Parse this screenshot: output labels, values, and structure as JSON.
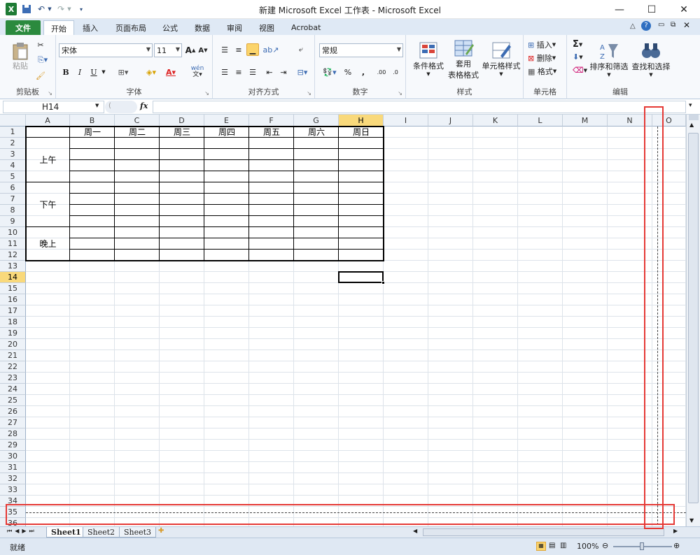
{
  "window": {
    "title": "新建 Microsoft Excel 工作表 - Microsoft Excel",
    "minimize": "—",
    "maximize": "☐",
    "close": "✕"
  },
  "quick_access": {
    "excel_icon": "excel-logo",
    "save": "save-icon",
    "undo": "undo-icon",
    "redo": "redo-icon",
    "customize": "customize-icon"
  },
  "tabs": [
    "文件",
    "开始",
    "插入",
    "页面布局",
    "公式",
    "数据",
    "审阅",
    "视图",
    "Acrobat"
  ],
  "active_tab": "开始",
  "ribbon": {
    "clipboard": {
      "label": "剪贴板",
      "paste": "粘贴"
    },
    "font": {
      "label": "字体",
      "name": "宋体",
      "size": "11",
      "bold": "B",
      "italic": "I",
      "underline": "U",
      "wen": "wén"
    },
    "alignment": {
      "label": "对齐方式"
    },
    "number": {
      "label": "数字",
      "format": "常规",
      "percent": "%",
      "comma": ","
    },
    "styles": {
      "label": "样式",
      "conditional": "条件格式",
      "table_format_1": "套用",
      "table_format_2": "表格格式",
      "cell_styles": "单元格样式"
    },
    "cells": {
      "label": "单元格",
      "insert": "插入",
      "delete": "删除",
      "format": "格式"
    },
    "editing": {
      "label": "编辑",
      "sigma": "Σ",
      "sort": "排序和筛选",
      "find": "查找和选择"
    }
  },
  "formula_bar": {
    "name_box": "H14",
    "fx": "fx",
    "content": ""
  },
  "columns": [
    "A",
    "B",
    "C",
    "D",
    "E",
    "F",
    "G",
    "H",
    "I",
    "J",
    "K",
    "L",
    "M",
    "N",
    "O"
  ],
  "active_column": "H",
  "rows": [
    "1",
    "2",
    "3",
    "4",
    "5",
    "6",
    "7",
    "8",
    "9",
    "10",
    "11",
    "12",
    "13",
    "14",
    "15",
    "16",
    "17",
    "18",
    "19",
    "20",
    "21",
    "22",
    "23",
    "24",
    "25",
    "26",
    "27",
    "28",
    "29",
    "30",
    "31",
    "32",
    "33",
    "34",
    "35",
    "36"
  ],
  "active_row": "14",
  "table": {
    "headers": [
      "周一",
      "周二",
      "周三",
      "周四",
      "周五",
      "周六",
      "周日"
    ],
    "periods": [
      "上午",
      "下午",
      "晚上"
    ]
  },
  "sheets": [
    "Sheet1",
    "Sheet2",
    "Sheet3"
  ],
  "status": {
    "ready": "就绪",
    "zoom": "100%"
  },
  "colors": {
    "file_tab": "#2b8a3e",
    "highlight": "#f9d97b",
    "annotation": "#e53935"
  }
}
